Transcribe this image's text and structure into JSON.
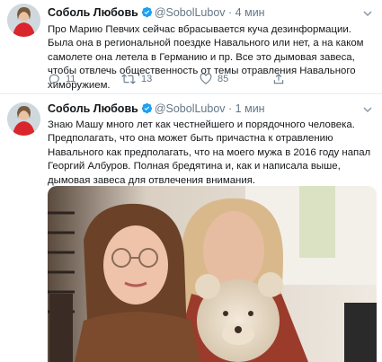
{
  "tweets": [
    {
      "name": "Соболь Любовь",
      "handle": "@SobolLubov",
      "dot": "·",
      "time": "4 мин",
      "text": "Про Марию Певчих сейчас вбрасывается куча дезинформации. Была она в региональной поездке Навального или нет, а на каком самолете она летела в Германию и пр. Все это дымовая завеса, чтобы отвлечь общественность от темы отравления Навального химоружием.",
      "replies": "11",
      "retweets": "13",
      "likes": "85"
    },
    {
      "name": "Соболь Любовь",
      "handle": "@SobolLubov",
      "dot": "·",
      "time": "1 мин",
      "text": "Знаю Машу много лет как честнейшего и порядочного человека. Предполагать, что она может быть причастна к отравлению Навального как предполагать, что на моего мужа в 2016 году напал Георгий Албуров. Полная бредятина и, как и написала выше, дымовая завеса для отвлечения внимания."
    }
  ],
  "icons": {
    "verified": "verified-badge-icon",
    "reply": "reply-icon",
    "retweet": "retweet-icon",
    "like": "heart-icon",
    "share": "share-icon",
    "menu": "chevron-down-icon"
  },
  "colors": {
    "accent": "#1da1f2",
    "muted": "#657786",
    "divider": "#e6ecf0"
  }
}
